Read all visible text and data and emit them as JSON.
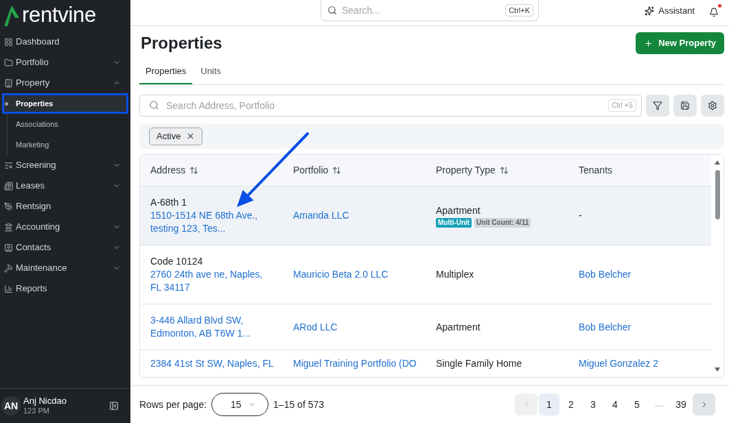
{
  "sidebar": {
    "logo": {
      "text": "rentvine"
    },
    "items": [
      {
        "label": "Dashboard",
        "kind": "link"
      },
      {
        "label": "Portfolio",
        "kind": "group",
        "expanded": false
      },
      {
        "label": "Property",
        "kind": "group",
        "expanded": true,
        "children": [
          {
            "label": "Properties",
            "selected": true,
            "highlighted": true
          },
          {
            "label": "Associations",
            "selected": false,
            "highlighted": false
          },
          {
            "label": "Marketing",
            "selected": false,
            "highlighted": false
          }
        ]
      },
      {
        "label": "Screening",
        "kind": "group",
        "expanded": false
      },
      {
        "label": "Leases",
        "kind": "group",
        "expanded": false
      },
      {
        "label": "Rentsign",
        "kind": "link"
      },
      {
        "label": "Accounting",
        "kind": "group",
        "expanded": false
      },
      {
        "label": "Contacts",
        "kind": "group",
        "expanded": false
      },
      {
        "label": "Maintenance",
        "kind": "group",
        "expanded": false
      },
      {
        "label": "Reports",
        "kind": "link"
      }
    ],
    "user": {
      "initials": "AN",
      "name": "Anj Nicdao",
      "subtitle": "123 PM"
    }
  },
  "top_bar": {
    "search": {
      "placeholder": "Search...",
      "shortcut": "Ctrl+K"
    },
    "assistant": {
      "label": "Assistant"
    },
    "notifications": {
      "unread": true
    }
  },
  "page": {
    "title": "Properties",
    "primary_action": {
      "label": "New Property"
    },
    "tabs": [
      {
        "label": "Properties",
        "selected": true
      },
      {
        "label": "Units",
        "selected": false
      }
    ],
    "search": {
      "placeholder": "Search Address, Portfolio",
      "shortcut": "Ctrl +S"
    },
    "filter_chips": [
      {
        "label": "Active"
      }
    ],
    "table": {
      "columns": [
        {
          "label": "Address",
          "sortable": true
        },
        {
          "label": "Portfolio",
          "sortable": true
        },
        {
          "label": "Property Type",
          "sortable": true
        },
        {
          "label": "Tenants",
          "sortable": false
        }
      ],
      "rows": [
        {
          "hovered": true,
          "address": {
            "code": "A-68th 1",
            "street": "1510-1514 NE 68th Ave., testing 123, Tes..."
          },
          "portfolio": "Amanda LLC",
          "property_type": {
            "label": "Apartment",
            "badges": [
              {
                "label": "Multi-Unit",
                "kind": "category"
              },
              {
                "label": "Unit Count: 4/11",
                "kind": "count"
              }
            ]
          },
          "tenant": {
            "text": "-",
            "kind": "empty"
          }
        },
        {
          "hovered": false,
          "address": {
            "code": "Code 10124",
            "street": "2760 24th ave ne, Naples, FL 34117"
          },
          "portfolio": "Mauricio Beta 2.0 LLC",
          "property_type": {
            "label": "Multiplex"
          },
          "tenant": {
            "text": "Bob Belcher",
            "kind": "link"
          }
        },
        {
          "hovered": false,
          "address": {
            "street": "3-446 Allard Blvd SW, Edmonton, AB T6W 1..."
          },
          "portfolio": "ARod LLC",
          "property_type": {
            "label": "Apartment"
          },
          "tenant": {
            "text": "Bob Belcher",
            "kind": "link"
          }
        },
        {
          "hovered": false,
          "address": {
            "street": "2384 41st St SW, Naples, FL"
          },
          "portfolio": "Miguel Training Portfolio (DO",
          "property_type": {
            "label": "Single Family Home"
          },
          "tenant": {
            "text": "Miguel Gonzalez 2",
            "kind": "link"
          }
        }
      ]
    },
    "pagination": {
      "label": "Rows per page:",
      "rows_per_page": "15",
      "range": "1–15 of 573",
      "previous": {
        "disabled": true
      },
      "next": {
        "disabled": false
      },
      "pages": [
        {
          "label": "1",
          "kind": "page",
          "selected": true
        },
        {
          "label": "2",
          "kind": "page",
          "selected": false
        },
        {
          "label": "3",
          "kind": "page",
          "selected": false
        },
        {
          "label": "4",
          "kind": "page",
          "selected": false
        },
        {
          "label": "5",
          "kind": "page",
          "selected": false
        },
        {
          "label": "…",
          "kind": "ellipsis",
          "selected": false
        },
        {
          "label": "39",
          "kind": "page",
          "selected": false
        }
      ]
    }
  }
}
